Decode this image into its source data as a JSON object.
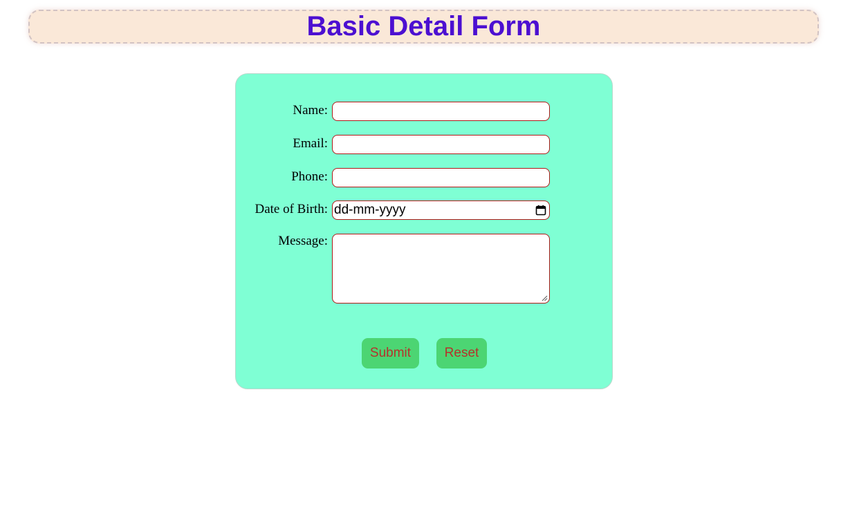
{
  "header": {
    "title": "Basic Detail Form"
  },
  "form": {
    "name_label": "Name:",
    "email_label": "Email:",
    "phone_label": "Phone:",
    "dob_label": "Date of Birth:",
    "dob_placeholder": "dd-mm-yyyy",
    "message_label": "Message:",
    "name_value": "",
    "email_value": "",
    "phone_value": "",
    "message_value": ""
  },
  "buttons": {
    "submit_label": "Submit",
    "reset_label": "Reset"
  },
  "colors": {
    "title": "#4c0fd1",
    "header_bg": "#fae8d8",
    "card_bg": "#7fffd4",
    "button_bg": "#4cd573",
    "button_text": "#b5332b",
    "field_border": "#b01818"
  },
  "icons": {
    "date_picker": "calendar-icon",
    "textarea_resize": "resize-handle-icon"
  }
}
